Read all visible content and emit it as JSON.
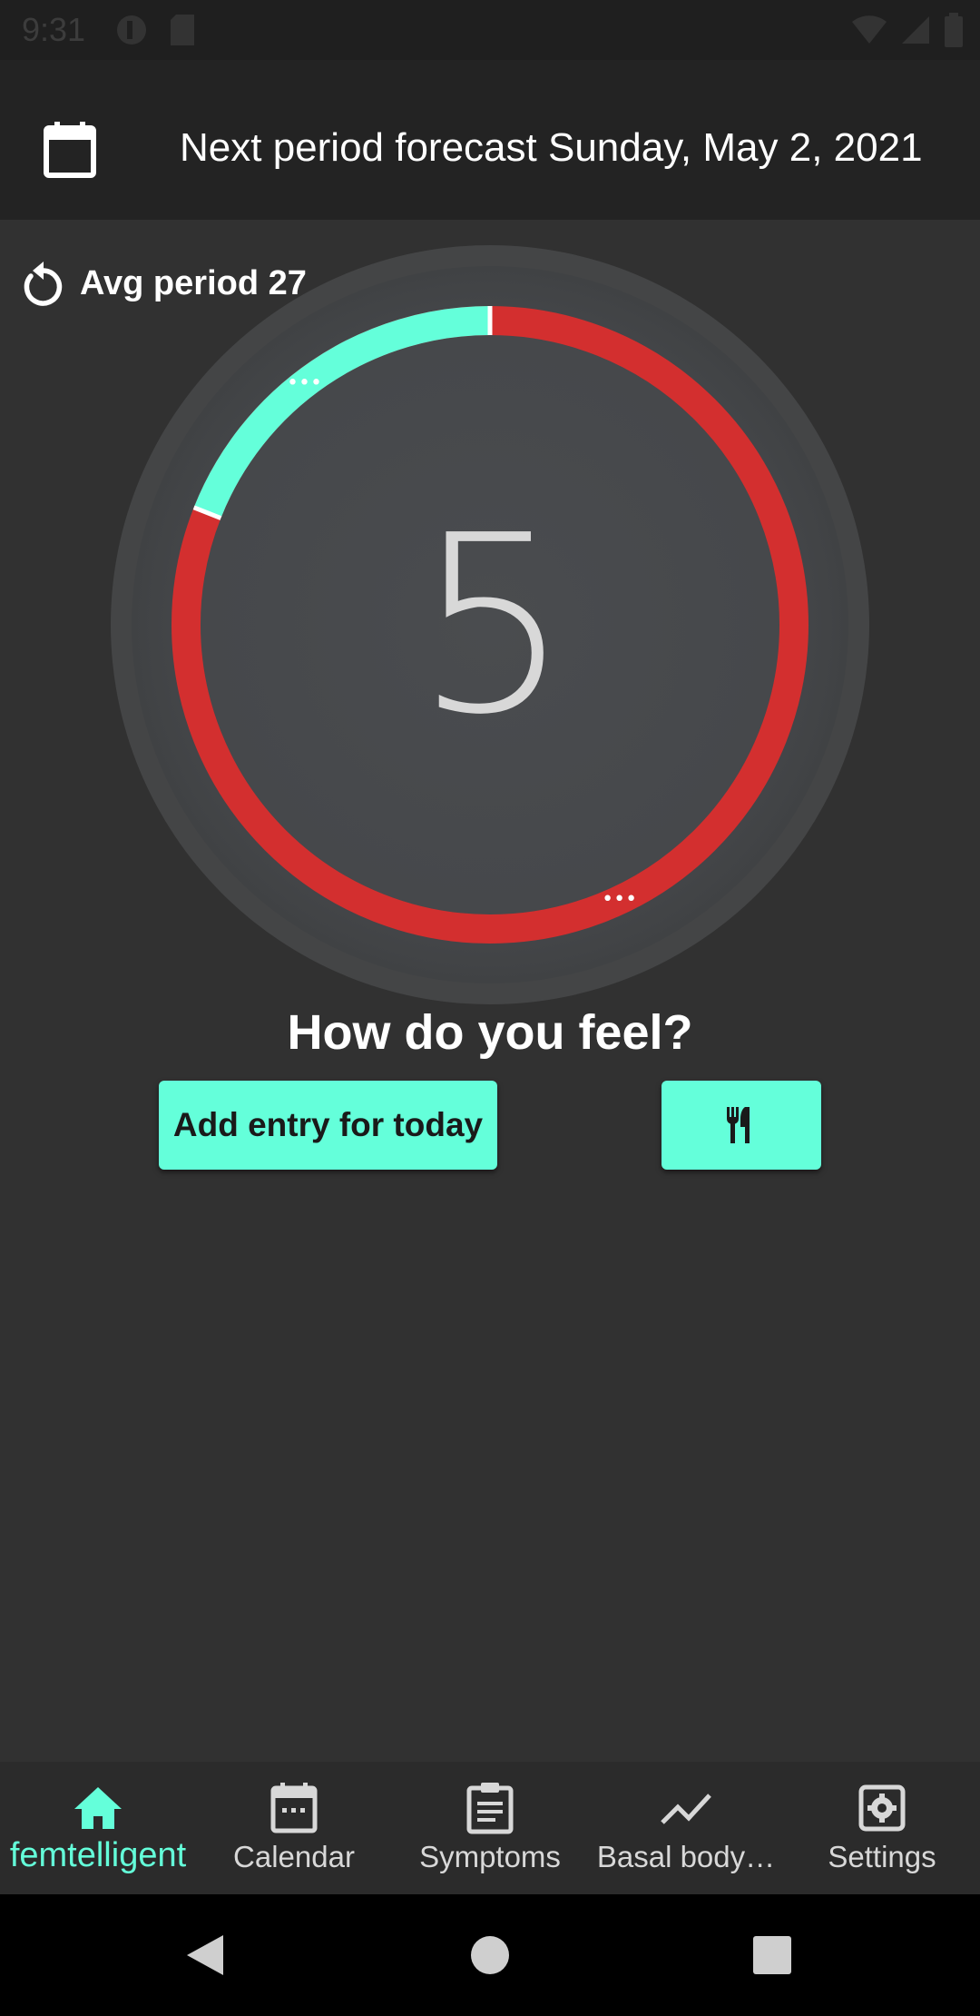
{
  "status_bar": {
    "time": "9:31"
  },
  "app_bar": {
    "forecast_text": "Next period forecast Sunday, May 2, 2021"
  },
  "cycle": {
    "avg_label": "Avg period 27",
    "current_day": "5",
    "cycle_length_days": 27,
    "highlight_fraction": 0.19,
    "ring_color": "#d32f2f",
    "highlight_color": "#64ffda"
  },
  "prompt": {
    "question": "How do you feel?",
    "add_entry_label": "Add entry for today"
  },
  "bottom_nav": {
    "items": [
      {
        "label": "femtelligent",
        "icon": "home-icon",
        "active": true
      },
      {
        "label": "Calendar",
        "icon": "calendar-icon",
        "active": false
      },
      {
        "label": "Symptoms",
        "icon": "clipboard-icon",
        "active": false
      },
      {
        "label": "Basal body…",
        "icon": "trending-icon",
        "active": false
      },
      {
        "label": "Settings",
        "icon": "settings-icon",
        "active": false
      }
    ]
  },
  "colors": {
    "accent": "#64ffda",
    "ring": "#d32f2f",
    "background": "#313131",
    "app_bar": "#232323"
  }
}
